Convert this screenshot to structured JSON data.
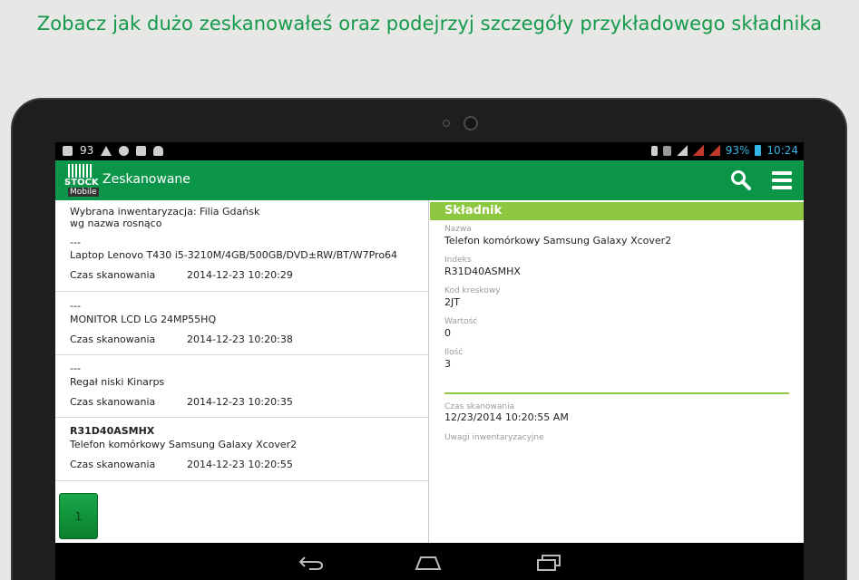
{
  "headline": "Zobacz jak dużo zeskanowałeś oraz podejrzyj szczegóły przykładowego składnika",
  "statusbar": {
    "left_count": "93",
    "battery_percent": "93%",
    "time": "10:24"
  },
  "app": {
    "logo_top": "STOCK",
    "logo_bottom": "Mobile",
    "title": "Zeskanowane"
  },
  "list": {
    "header_line1": "Wybrana inwentaryzacja: Filia Gdańsk",
    "header_line2": "wg nazwa rosnąco",
    "items": [
      {
        "code": "---",
        "name": "Laptop Lenovo T430 i5-3210M/4GB/500GB/DVD±RW/BT/W7Pro64",
        "scan_label": "Czas skanowania",
        "scan_time": "2014-12-23 10:20:29"
      },
      {
        "code": "---",
        "name": "MONITOR LCD LG 24MP55HQ",
        "scan_label": "Czas skanowania",
        "scan_time": "2014-12-23 10:20:38"
      },
      {
        "code": "---",
        "name": "Regał niski Kinarps",
        "scan_label": "Czas skanowania",
        "scan_time": "2014-12-23 10:20:35"
      },
      {
        "code": "R31D40ASMHX",
        "name": "Telefon komórkowy Samsung Galaxy Xcover2",
        "scan_label": "Czas skanowania",
        "scan_time": "2014-12-23 10:20:55"
      }
    ],
    "page": "1"
  },
  "detail": {
    "header": "Składnik",
    "fields": [
      {
        "label": "Nazwa",
        "value": "Telefon komórkowy Samsung Galaxy Xcover2"
      },
      {
        "label": "Indeks",
        "value": "R31D40ASMHX"
      },
      {
        "label": "Kod kreskowy",
        "value": "2JT"
      },
      {
        "label": "Wartość",
        "value": "0"
      },
      {
        "label": "Ilość",
        "value": "3"
      }
    ],
    "scan_label": "Czas skanowania",
    "scan_value": "12/23/2014 10:20:55 AM",
    "notes_label": "Uwagi inwentaryzacyjne"
  },
  "colors": {
    "headline": "#139a4b",
    "actionbar": "#0b9548",
    "accent": "#8dc63f"
  },
  "icons": [
    "search-icon",
    "menu-icon",
    "back-icon",
    "home-icon",
    "recent-apps-icon"
  ]
}
